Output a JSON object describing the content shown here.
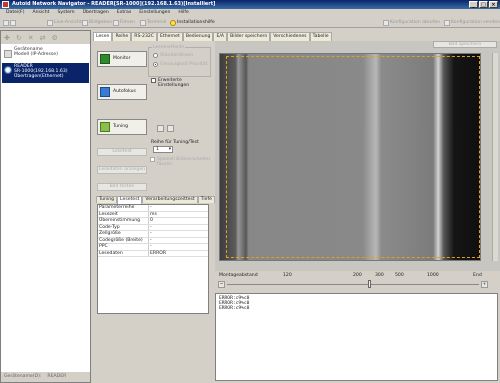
{
  "window": {
    "title": "Autoid Network Navigator - READER[SR-1000](192.168.1.63)[Installiert]"
  },
  "menu": [
    "Datei(F)",
    "Ansicht",
    "System",
    "Übertragen",
    "Extras",
    "Einstellungen",
    "Hilfe"
  ],
  "toolbar": {
    "items": [
      "Live-Ansicht",
      "Bildgeben",
      "Filmen",
      "Terminal"
    ],
    "install_help": "Installationshilfe",
    "config_load": "Konfiguration abrufen",
    "config_send": "Konfiguration senden",
    "firmware": "Firmware aktualisieren"
  },
  "tree": {
    "root_title": "Gerätename",
    "root_sub": "Modell (IP-Adresse)",
    "device_name": "READER",
    "device_model": "SR-1000(192.168.1.63)",
    "device_state": "Übertragen(Ethernet)"
  },
  "status": {
    "label": "Gerätename(D):",
    "value": "READER"
  },
  "tabs": [
    "Lesen",
    "Reihe",
    "RS-232C",
    "Ethernet",
    "Bedienung",
    "E/A",
    "Bilder speichern",
    "Verschiedenes",
    "Tabelle"
  ],
  "mid": {
    "monitor": "Monitor",
    "autofocus": "Autofokus",
    "tuning": "Tuning",
    "btn_disabled_1": "Lesetest",
    "btn_disabled_2": "Lesedaten anzeigen",
    "btn_disabled_3": "Bild testen",
    "group_title": "Lesemethode",
    "radio_1": "Standardlesen",
    "radio_2": "Genauigkeit Priorität",
    "ext_settings": "Erweiterte Einstellungen",
    "tuning_row_label": "Reihe für Tuning/Test",
    "tuning_row_value": "1",
    "checkbox_label": "Speziell Bildverarbeiter fassen",
    "subtabs": [
      "Tuning",
      "Lesetest",
      "Verarbeitungszeittest",
      "Tiefe"
    ]
  },
  "params": [
    {
      "k": "Parameterreihe",
      "v": "-"
    },
    {
      "k": "Lesezeit",
      "v": "ms"
    },
    {
      "k": "Übereinstimmung",
      "v": "0"
    },
    {
      "k": "Code-Typ",
      "v": "-"
    },
    {
      "k": "Zellgröße",
      "v": "-"
    },
    {
      "k": "Codegröße (Breite)",
      "v": "-"
    },
    {
      "k": "PPC",
      "v": "-"
    },
    {
      "k": "Lesedaten",
      "v": "ERROR"
    }
  ],
  "image": {
    "top_button": "Bild speichern"
  },
  "zoom": {
    "label": "Montageabstand",
    "ticks": [
      "120",
      "200",
      "300",
      "500",
      "1000"
    ],
    "end_label": "End"
  },
  "log": [
    "ERROR:c9%c0",
    "ERROR:c9%c0",
    "ERROR:c9%c0"
  ]
}
